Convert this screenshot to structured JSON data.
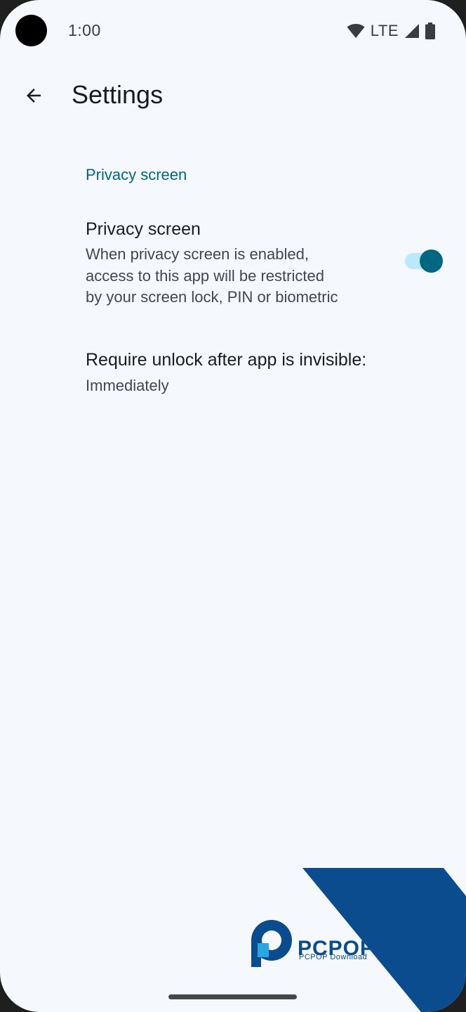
{
  "status_bar": {
    "time": "1:00",
    "network": "LTE",
    "icons": [
      "wifi-icon",
      "signal-icon",
      "battery-icon"
    ]
  },
  "app_bar": {
    "title": "Settings",
    "back_icon": "arrow-back-icon"
  },
  "sections": {
    "privacy": {
      "header": "Privacy screen",
      "privacy_pref": {
        "title": "Privacy screen",
        "summary_lines": [
          "When privacy screen is enabled,",
          "access to this app will be restricted",
          "by your screen lock, PIN or biometric"
        ],
        "enabled": true
      },
      "unlock_pref": {
        "title": "Require unlock after app is invisible:",
        "summary": "Immediately"
      }
    }
  },
  "watermark": {
    "brand": "PCPOP下载",
    "subtitle": "PCPOP Download"
  },
  "colors": {
    "background": "#f5f9fe",
    "accent": "#006783",
    "switch_track": "#b9e9fc",
    "watermark_blue": "#0b4c8e"
  }
}
